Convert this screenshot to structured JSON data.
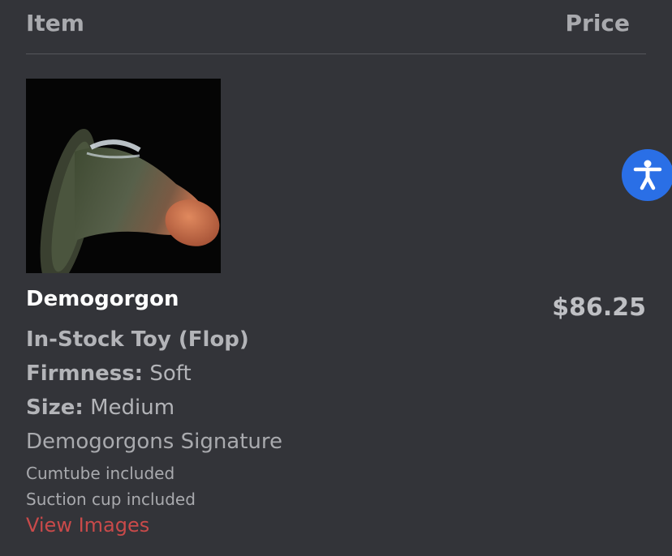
{
  "header": {
    "item_label": "Item",
    "price_label": "Price"
  },
  "product": {
    "name": "Demogorgon",
    "price": "$86.25",
    "variant": "In-Stock Toy (Flop)",
    "firmness_label": "Firmness:",
    "firmness_value": "Soft",
    "size_label": "Size:",
    "size_value": "Medium",
    "signature": "Demogorgons Signature",
    "extra1": "Cumtube included",
    "extra2": "Suction cup included",
    "view_images": "View Images",
    "thumbnail_icon": "product-photo"
  },
  "accessibility": {
    "icon": "accessibility-person-icon",
    "color": "#2a6fe6"
  },
  "colors": {
    "background": "#333439",
    "link": "#c94a4a",
    "name": "#ffffff"
  }
}
